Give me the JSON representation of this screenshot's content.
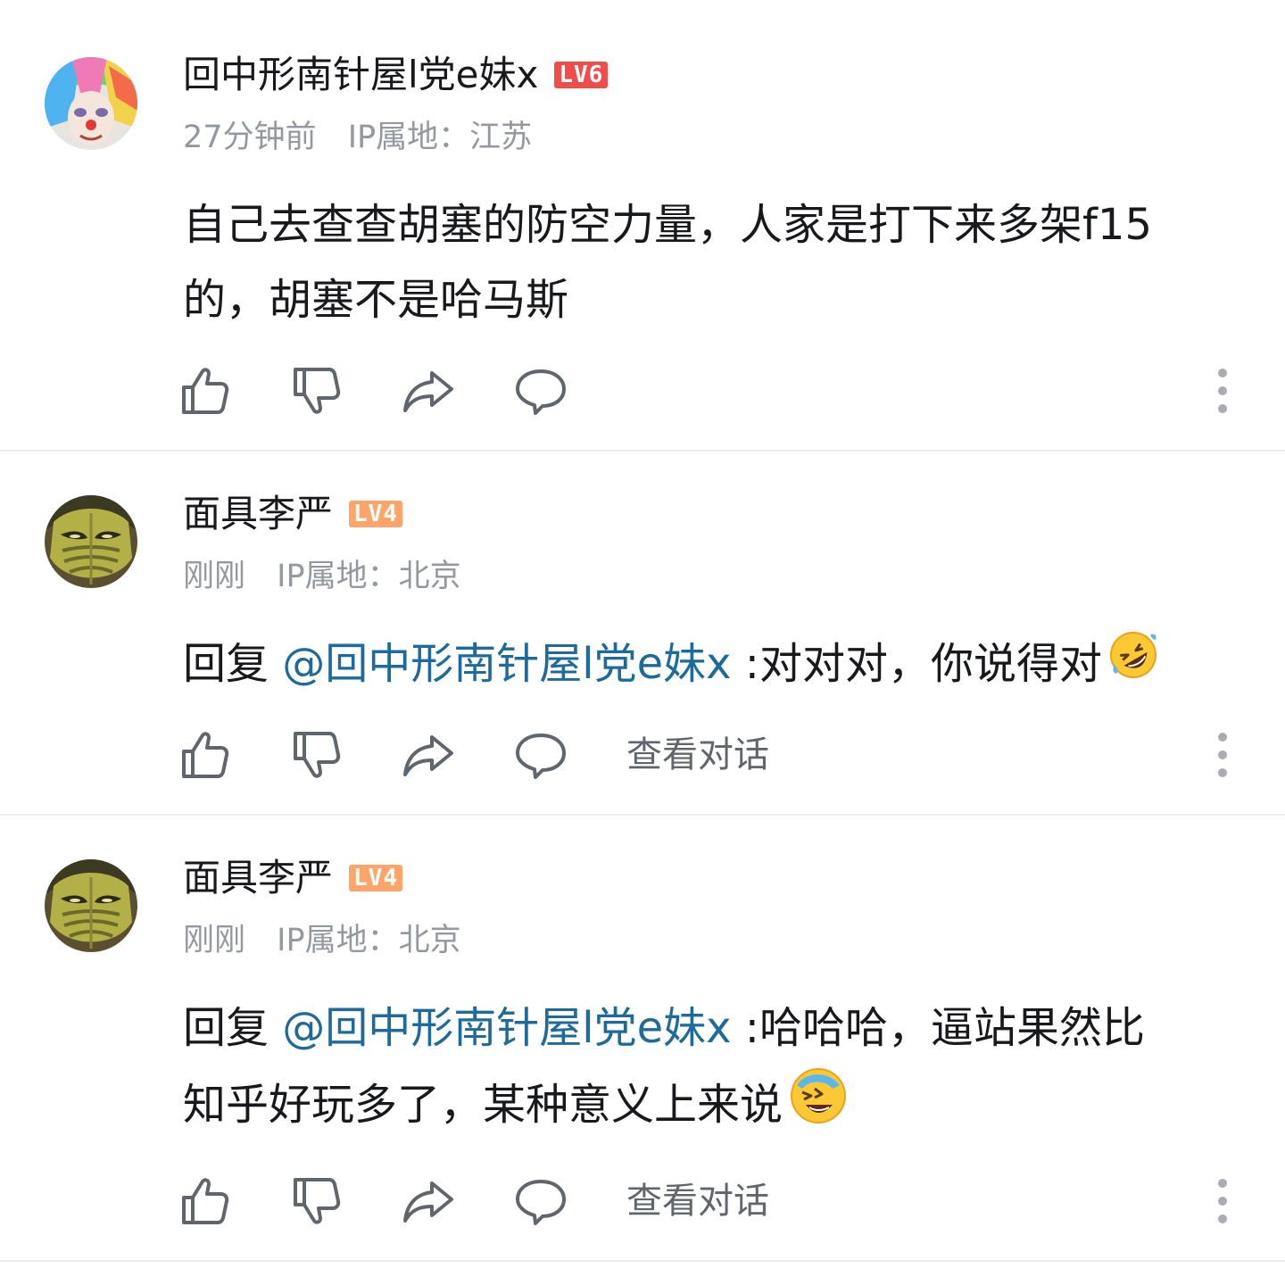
{
  "comments": [
    {
      "username": "回中形南针屋l党e妹x",
      "level": "LV6",
      "level_color": "#f04c49",
      "time": "27分钟前",
      "ip": "IP属地：江苏",
      "content_line1": "自己去查查胡塞的防空力量，人家是打下来多架f15",
      "content_line2": "的，胡塞不是哈马斯",
      "avatar": "rainbow-hair-clown-avatar"
    },
    {
      "username": "面具李严",
      "level": "LV4",
      "level_color": "#ffa569",
      "time": "刚刚",
      "ip": "IP属地：北京",
      "reply_prefix": "回复 ",
      "mention": "@回中形南针屋l党e妹x",
      "content": " :对对对，你说得对",
      "emoji": "rolling-on-floor-laughing-emoji",
      "view_conversation": "查看对话",
      "avatar": "green-mask-avatar"
    },
    {
      "username": "面具李严",
      "level": "LV4",
      "level_color": "#ffa569",
      "time": "刚刚",
      "ip": "IP属地：北京",
      "reply_prefix": "回复 ",
      "mention": "@回中形南针屋l党e妹x",
      "content_line1": " :哈哈哈，逼站果然比",
      "content_line2": "知乎好玩多了，某种意义上来说",
      "emoji": "laughing-tears-emoji",
      "view_conversation": "查看对话",
      "avatar": "green-mask-avatar"
    }
  ],
  "colors": {
    "text": "#18191c",
    "meta": "#9499a0",
    "mention": "#1e6a9a",
    "icon": "#61666d",
    "divider": "#ececec"
  }
}
